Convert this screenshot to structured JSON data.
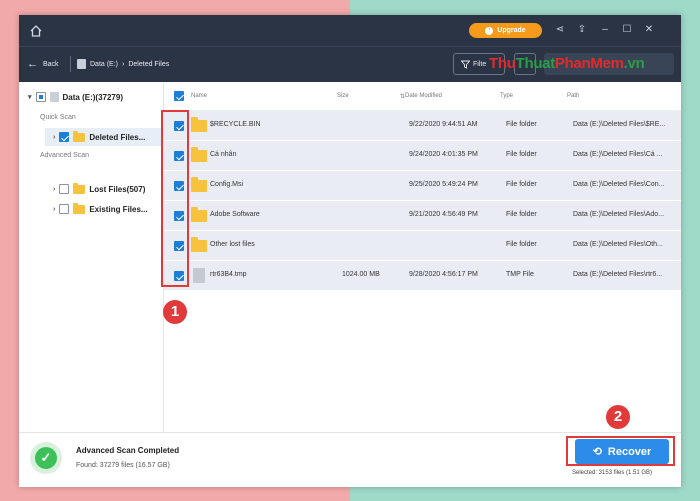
{
  "titlebar": {
    "upgrade_label": "Upgrade"
  },
  "navbar": {
    "back_label": "Back",
    "breadcrumb": [
      "Data (E:)",
      "Deleted Files"
    ],
    "filter_label": "Filte"
  },
  "watermark": {
    "part1": "Thu",
    "part2": "Thuat",
    "part3": "PhanMem",
    "part4": ".vn"
  },
  "sidebar": {
    "root_label": "Data (E:)(37279)",
    "quick_scan_label": "Quick Scan",
    "deleted_files_label": "Deleted Files...",
    "advanced_scan_label": "Advanced Scan",
    "lost_files_label": "Lost Files(507)",
    "existing_files_label": "Existing Files..."
  },
  "table": {
    "headers": {
      "name": "Name",
      "size": "Size",
      "date": "Date Modified",
      "type": "Type",
      "path": "Path"
    },
    "rows": [
      {
        "name": "$RECYCLE.BIN",
        "size": "",
        "date": "9/22/2020 9:44:51 AM",
        "type": "File folder",
        "path": "Data (E:)\\Deleted Files\\$RE...",
        "kind": "folder"
      },
      {
        "name": "Cá nhân",
        "size": "",
        "date": "9/24/2020 4:01:35 PM",
        "type": "File folder",
        "path": "Data (E:)\\Deleted Files\\Cá ...",
        "kind": "folder"
      },
      {
        "name": "Config.Msi",
        "size": "",
        "date": "9/25/2020 5:49:24 PM",
        "type": "File folder",
        "path": "Data (E:)\\Deleted Files\\Con...",
        "kind": "folder"
      },
      {
        "name": "Adobe Software",
        "size": "",
        "date": "9/21/2020 4:56:49 PM",
        "type": "File folder",
        "path": "Data (E:)\\Deleted Files\\Ado...",
        "kind": "folder"
      },
      {
        "name": "Other lost files",
        "size": "",
        "date": "",
        "type": "File folder",
        "path": "Data (E:)\\Deleted Files\\Oth...",
        "kind": "folder"
      },
      {
        "name": "rtr63B4.tmp",
        "size": "1024.00 MB",
        "date": "9/28/2020 4:56:17 PM",
        "type": "TMP File",
        "path": "Data (E:)\\Deleted Files\\rtr6...",
        "kind": "file"
      }
    ]
  },
  "footer": {
    "status_title": "Advanced Scan Completed",
    "status_sub": "Found: 37279 files (16.57 GB)",
    "recover_label": "Recover",
    "selected_text": "Selected: 3153 files (1.51 GB)"
  },
  "annotations": {
    "badge1": "1",
    "badge2": "2"
  },
  "colors": {
    "accent": "#2d8ce9",
    "highlight": "#e03a3a",
    "titlebar": "#2b3445",
    "upgrade": "#f59a1b"
  }
}
